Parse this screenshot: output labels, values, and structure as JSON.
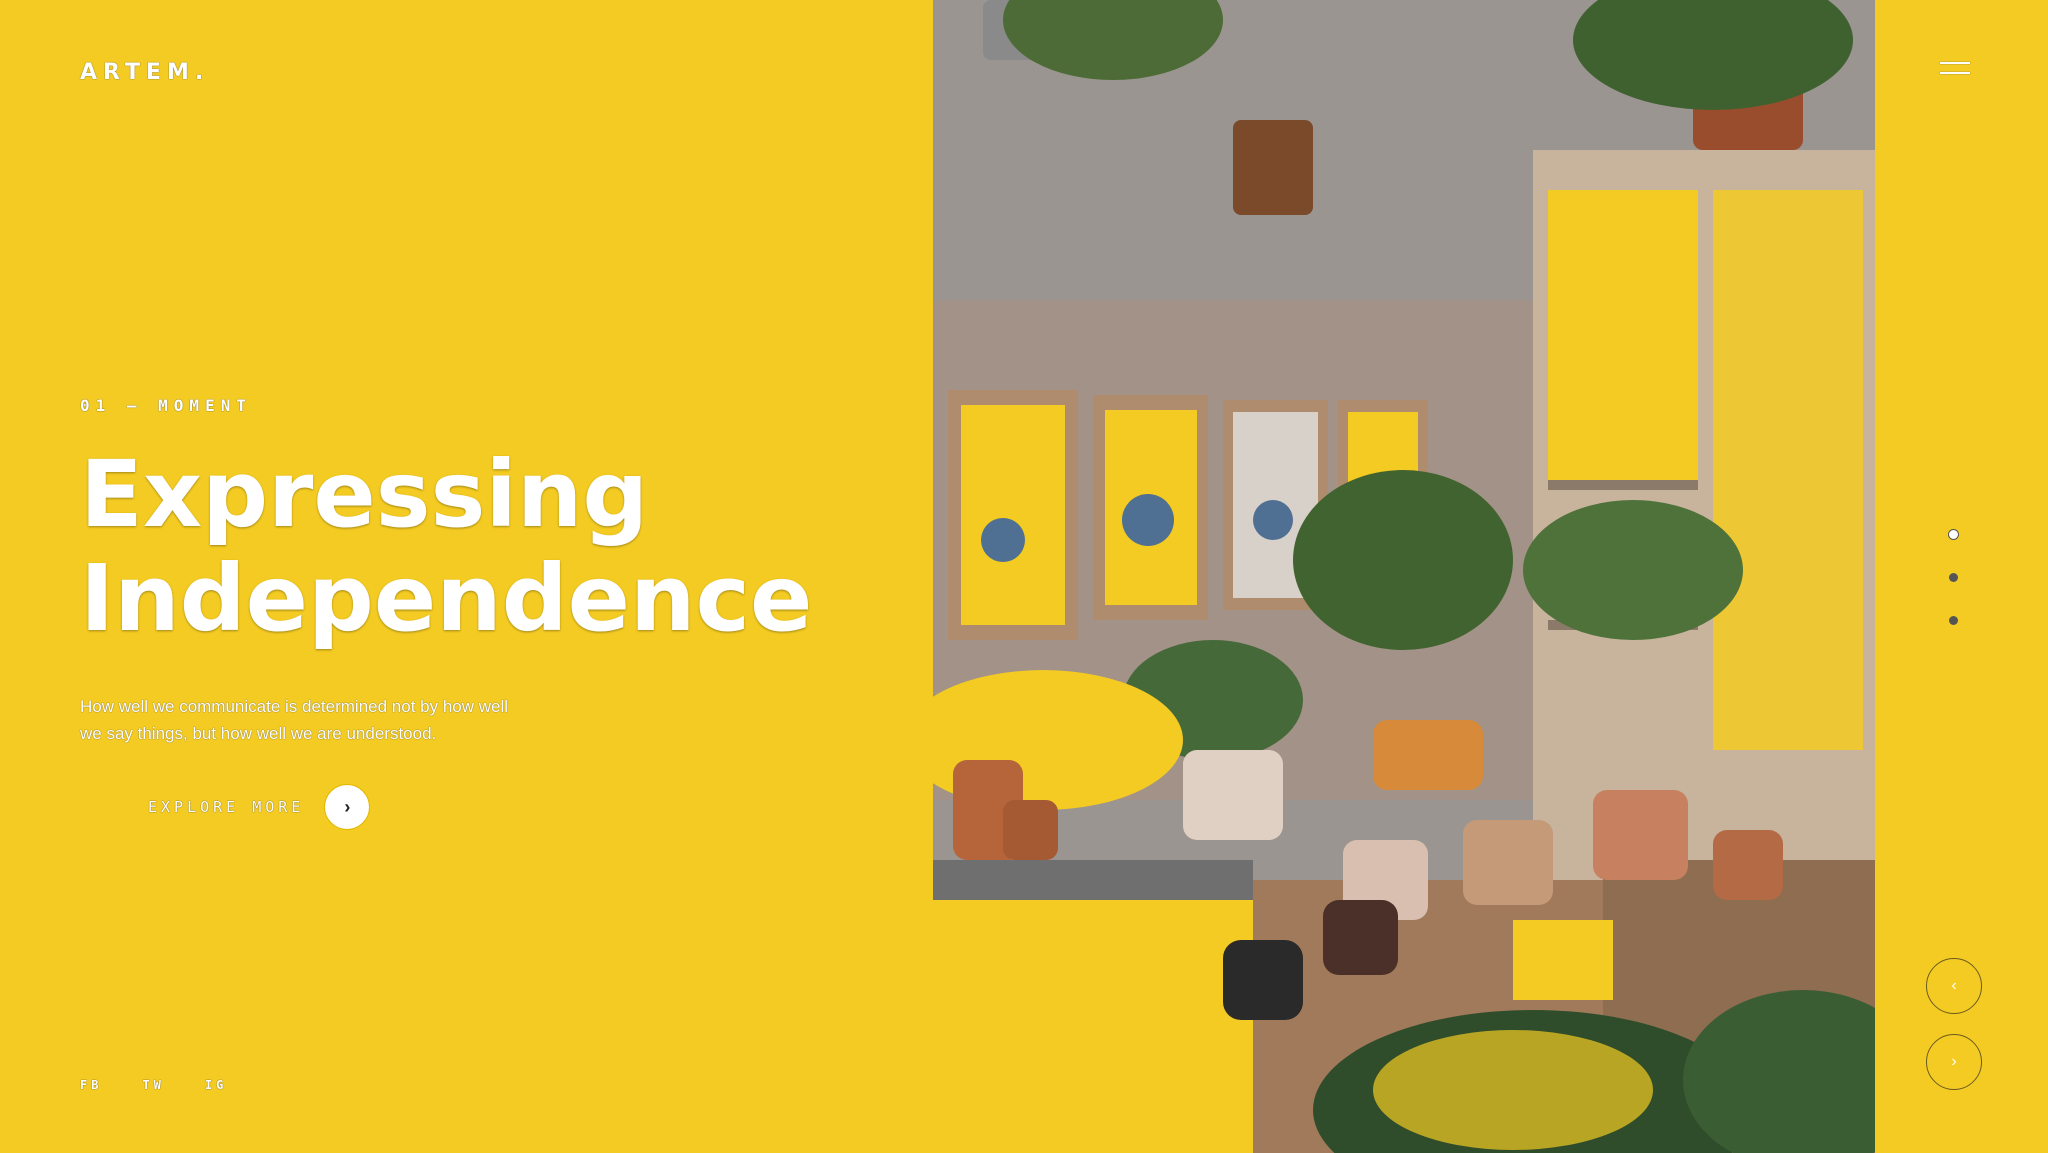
{
  "brand": {
    "logo_text": "ARTEM."
  },
  "hero": {
    "eyebrow": "01 — MOMENT",
    "title_line1": "Expressing",
    "title_line2": "Independence",
    "subtitle": "How well we communicate is determined not by how well we say things, but how well we are understood.",
    "cta_label": "EXPLORE MORE",
    "cta_icon": "chevron-right-icon"
  },
  "social": {
    "items": [
      "FB",
      "TW",
      "IG"
    ]
  },
  "slider": {
    "total_slides": 3,
    "active_slide": 1,
    "prev_icon": "chevron-left-icon",
    "next_icon": "chevron-right-icon"
  },
  "colors": {
    "background": "#f4cb22",
    "text": "#ffffff",
    "dark": "#222222"
  },
  "icons": {
    "menu": "hamburger-menu-icon"
  }
}
